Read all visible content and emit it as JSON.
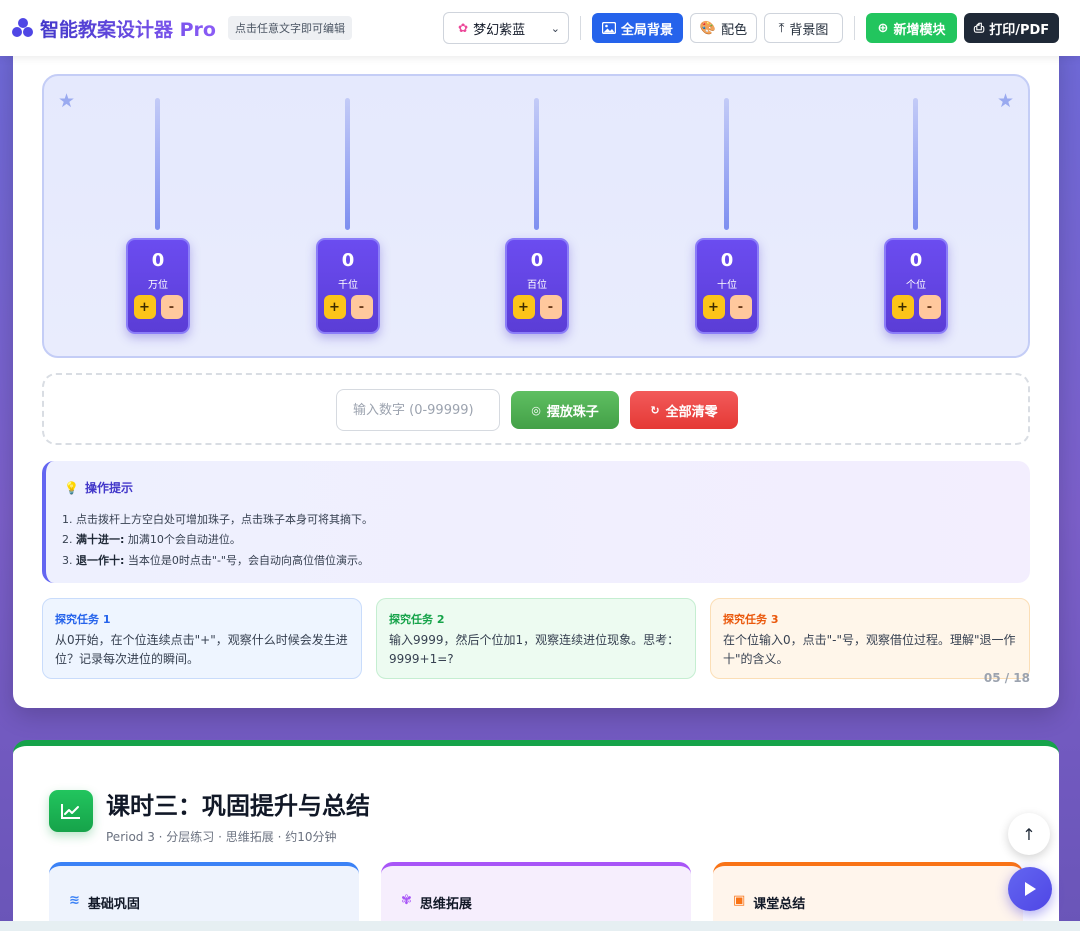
{
  "toolbar": {
    "app_title": "智能教案设计器 Pro",
    "edit_hint": "点击任意文字即可编辑",
    "theme_selected": "梦幻紫蓝",
    "btn_global_bg": "全局背景",
    "btn_color": "配色",
    "btn_bg_image": "背景图",
    "btn_add_module": "新增模块",
    "btn_print": "打印/PDF"
  },
  "abacus": {
    "places": [
      {
        "name": "万位",
        "value": "0"
      },
      {
        "name": "千位",
        "value": "0"
      },
      {
        "name": "百位",
        "value": "0"
      },
      {
        "name": "十位",
        "value": "0"
      },
      {
        "name": "个位",
        "value": "0"
      }
    ],
    "plus_label": "+",
    "minus_label": "-"
  },
  "controls": {
    "input_placeholder": "输入数字 (0-99999)",
    "place_beads_label": "摆放珠子",
    "clear_all_label": "全部清零"
  },
  "tips": {
    "title": "操作提示",
    "line1": "1. 点击拨杆上方空白处可增加珠子，点击珠子本身可将其摘下。",
    "line2_prefix": "2. ",
    "line2_bold": "满十进一:",
    "line2_rest": " 加满10个会自动进位。",
    "line3_prefix": "3. ",
    "line3_bold": "退一作十:",
    "line3_rest": " 当本位是0时点击\"-\"号，会自动向高位借位演示。"
  },
  "tasks": [
    {
      "title": "探究任务 1",
      "body": "从0开始，在个位连续点击\"+\"，观察什么时候会发生进位？记录每次进位的瞬间。"
    },
    {
      "title": "探究任务 2",
      "body": "输入9999，然后个位加1，观察连续进位现象。思考：9999+1=?"
    },
    {
      "title": "探究任务 3",
      "body": "在个位输入0，点击\"-\"号，观察借位过程。理解\"退一作十\"的含义。"
    }
  ],
  "page_indicator": "05 / 18",
  "section": {
    "title": "课时三：巩固提升与总结",
    "subtitle": "Period 3 · 分层练习 · 思维拓展 · 约10分钟",
    "cards": [
      "基础巩固",
      "思维拓展",
      "课堂总结"
    ]
  },
  "colors": {
    "accent": "#4f46e5",
    "abacus_box": "#5b3dd6",
    "section_accent": "#16a34a"
  }
}
